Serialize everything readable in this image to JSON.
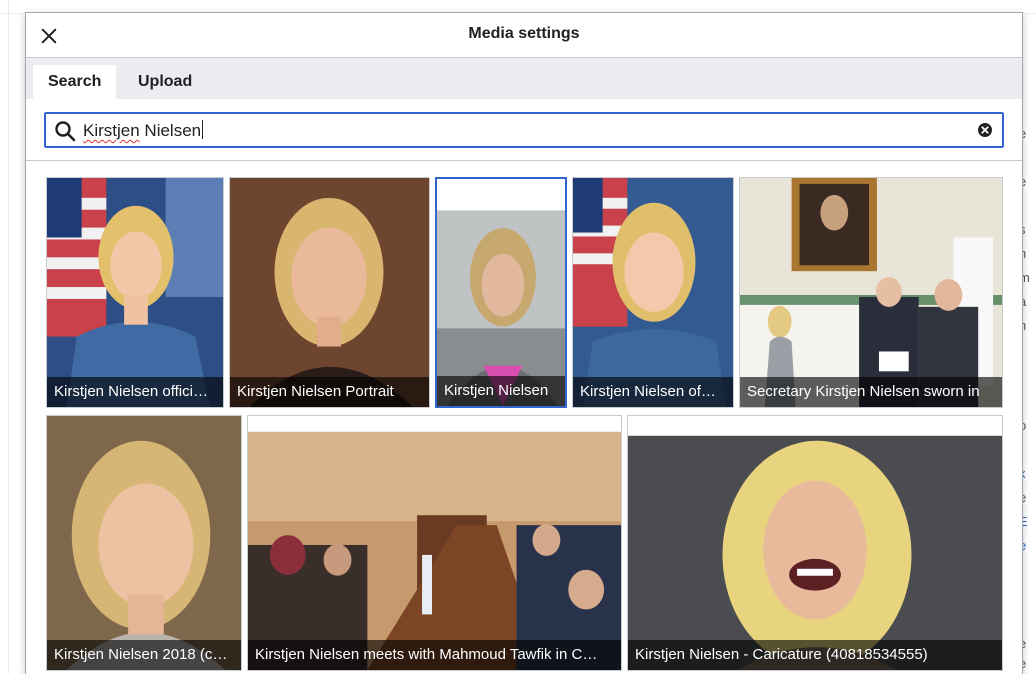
{
  "dialog": {
    "title": "Media settings",
    "close_icon": "close-icon"
  },
  "tabs": [
    {
      "label": "Search",
      "active": true
    },
    {
      "label": "Upload",
      "active": false
    }
  ],
  "search": {
    "value_misspelled": "Kirstjen",
    "value_rest": " Nielsen",
    "icon": "search-icon",
    "clear_icon": "clear-icon"
  },
  "results": [
    {
      "caption": "Kirstjen Nielsen offici…"
    },
    {
      "caption": "Kirstjen Nielsen Portrait"
    },
    {
      "caption": "Kirstjen Nielsen",
      "selected": true
    },
    {
      "caption": "Kirstjen Nielsen of…"
    },
    {
      "caption": "Secretary Kirstjen Nielsen sworn in"
    },
    {
      "caption": "Kirstjen Nielsen 2018 (c…"
    },
    {
      "caption": "Kirstjen Nielsen meets with Mahmoud Tawfik in C…"
    },
    {
      "caption": "Kirstjen Nielsen - Caricature (40818534555)"
    }
  ],
  "colors": {
    "accent": "#3366cc",
    "header_bg": "#eaecf0",
    "caption_bg": "rgba(0,0,0,0.62)"
  }
}
